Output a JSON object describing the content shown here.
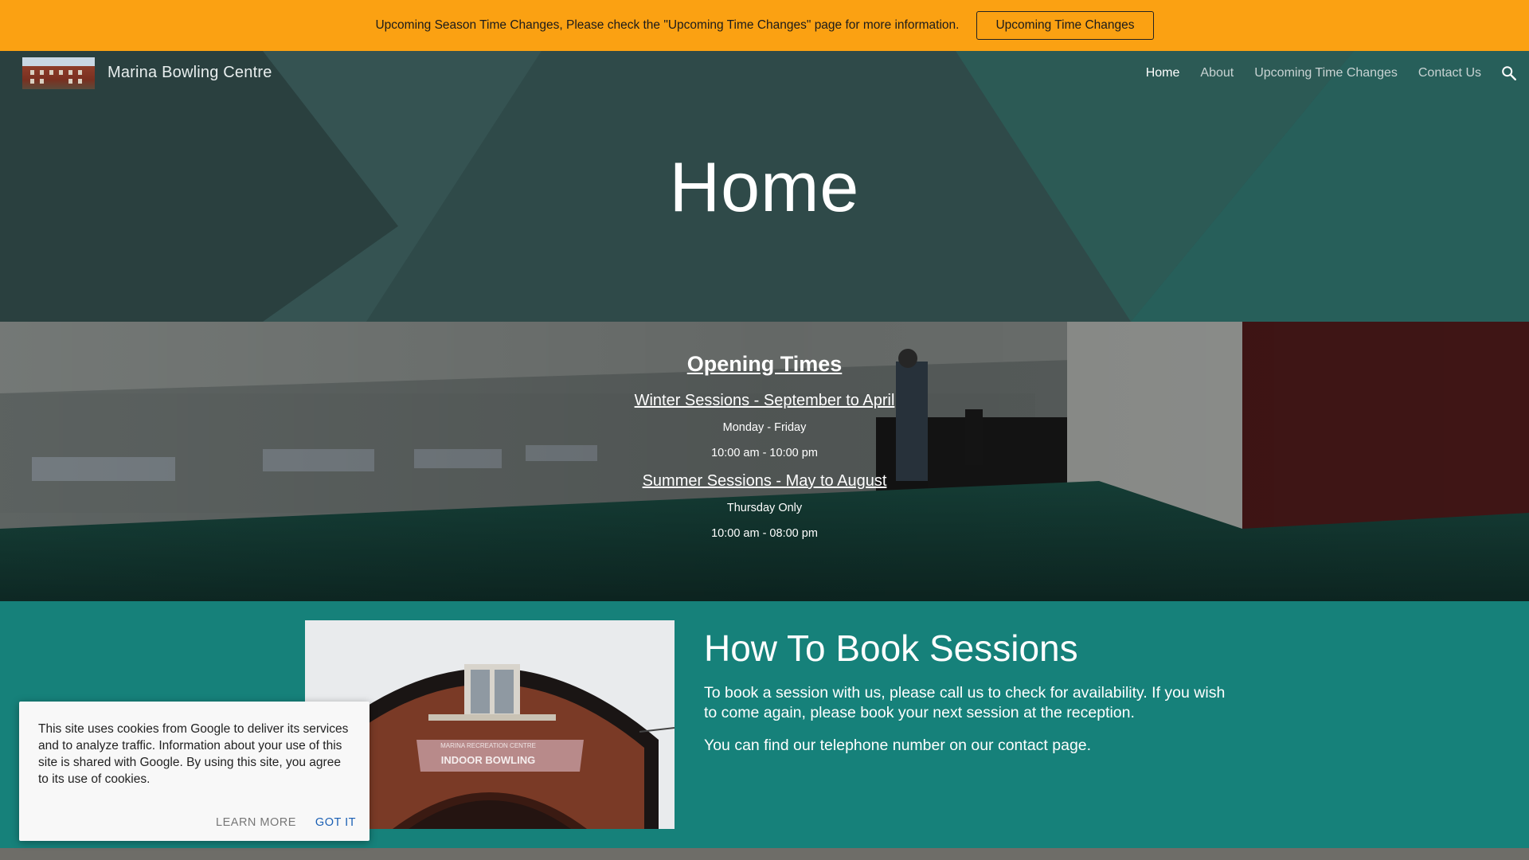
{
  "banner": {
    "text": "Upcoming Season Time Changes, Please check the \"Upcoming Time Changes\" page for more information.",
    "button_label": "Upcoming Time Changes",
    "color": "#fba112"
  },
  "header": {
    "site_title": "Marina Bowling Centre",
    "nav": [
      {
        "label": "Home",
        "active": true
      },
      {
        "label": "About"
      },
      {
        "label": "Upcoming Time Changes"
      },
      {
        "label": "Contact Us"
      }
    ],
    "search_icon": "search-icon",
    "page_title": "Home"
  },
  "opening_times": {
    "heading": "Opening Times",
    "winter": {
      "heading": "Winter Sessions - September to April",
      "days": "Monday - Friday",
      "hours": "10:00 am - 10:00 pm"
    },
    "summer": {
      "heading": "Summer Sessions - May to August",
      "days": "Thursday Only",
      "hours": "10:00 am - 08:00 pm"
    }
  },
  "booking": {
    "title": "How To Book Sessions",
    "paragraph1": "To book a session with us, please call us to check for availability. If you wish to come again, please book your next session at the reception.",
    "paragraph2": "You can find our telephone number on our contact page.",
    "building_sign_top": "MARINA RECREATION CENTRE",
    "building_sign_main": "INDOOR BOWLING",
    "color": "#16817a"
  },
  "cookie": {
    "text": "This site uses cookies from Google to deliver its services and to analyze traffic. Information about your use of this site is shared with Google. By using this site, you agree to its use of cookies.",
    "learn_more": "Learn more",
    "got_it": "Got it"
  }
}
